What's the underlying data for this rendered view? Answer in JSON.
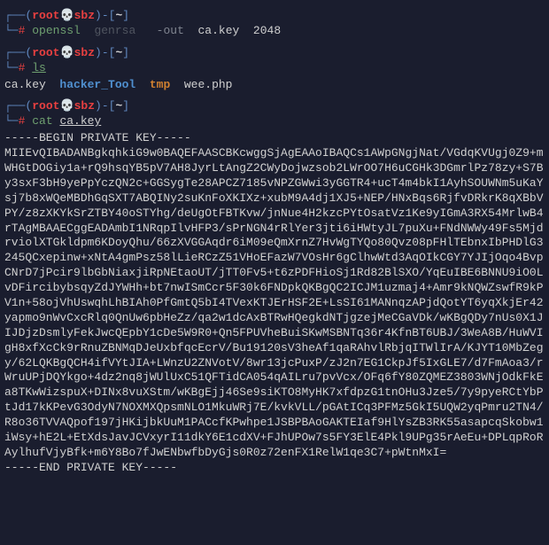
{
  "prompt": {
    "dash_pre": "┌──",
    "lparen": "(",
    "user": "root",
    "skull": "💀",
    "host": "sbz",
    "rparen": ")",
    "sep": "-",
    "lbracket": "[",
    "path": "~",
    "rbracket": "]",
    "dash_cont": "└─",
    "hash": "#"
  },
  "cmd1": {
    "bin": "openssl",
    "sub": "genrsa",
    "flag": "-out",
    "file": "ca.key",
    "bits": "2048"
  },
  "cmd2": {
    "bin": "ls"
  },
  "ls_out": {
    "f1": "ca.key",
    "d1": "hacker_Tool",
    "d2": "tmp",
    "f2": "wee.php"
  },
  "cmd3": {
    "bin": "cat",
    "file": "ca.key"
  },
  "key": {
    "begin": "-----BEGIN PRIVATE KEY-----",
    "body": "MIIEvQIBADANBgkqhkiG9w0BAQEFAASCBKcwggSjAgEAAoIBAQCs1AWpGNgjNat/VGdqKVUgj0Z9+mWHGtDOGiy1a+rQ9hsqYB5pV7AH8JyrLtAngZ2CWyDojwzsob2LWrOO7H6uCGHk3DGmrlPz78zy+S7By3sxF3bH9yePpYczQN2c+GGSygTe28APCZ7185vNPZGWwi3yGGTR4+ucT4m4bkI1AyhSOUWNm5uKaYsj7b8xWQeMBDhGqSXT7ABQINy2suKnFoXKIXz+xubM9A4dj1XJ5+NEP/HNxBqs6RjfvDRkrK8qXBbVPY/z8zXKYkSrZTBY40oSTYhg/deUgOtFBTKvw/jnNue4H2kzcPYtOsatVz1Ke9yIGmA3RX54MrlwB4rTAgMBAAECggEADAmbI1NRqpIlvHFP3/sPrNGN4rRlYer3jti6iHWtyJL7puXu+FNdNWWy49Fs5MjdrviolXTGkldpm6KDoyQhu/66zXVGGAqdr6iM09eQmXrnZ7HvWgTYQo80Qvz08pFHlTEbnxIbPHDlG3245QCxepinw+xNtA4gmPsz58lLieRCzZ51VHoEFazW7VOsHr6gClhwWtd3AqOIkCGY7YJIjOqo4BvpCNrD7jPcir9lbGbNiaxjiRpNEtaoUT/jTT0Fv5+t6zPDFHioSj1Rd82BlSXO/YqEuIBE6BNNU9iO0LvDFircibybsqyZdJYWHh+bt7nwISmCcr5F30k6FNDpkQKBgQC2ICJM1uzmaj4+Amr9kNQWZswfR9kPV1n+58ojVhUswqhLhBIAh0PfGmtQ5bI4TVexKTJErHSF2E+LsSI61MANnqzAPjdQotYT6yqXkjEr42yapmo9nWvCxcRlq0QnUw6pbHeZz/qa2w1dcAxBTRwHQegkdNTjgzejMeCGaVDk/wKBgQDy7nUs0X1JIJDjzDsmlyFekJwcQEpbY1cDe5W9R0+Qn5FPUVheBuiSKwMSBNTq36r4KfnBT6UBJ/3WeA8B/HuWVIgH8xfXcCk9rRnuZBNMqDJeUxbfqcEcrV/Bu19120sV3heAf1qaRAhvlRbjqITWlIrA/KJYT10MbZegy/62LQKBgQCH4ifVYtJIA+LWnzU2ZNVotV/8wr13jcPuxP/zJ2n7EG1CkpJf5IxGLE7/d7FmAoa3/rWruUPjDQYkgo+4dz2nq8jWUlUxC51QFTidCA054qAILru7pvVcx/OFq6fY80ZQMEZ3803WNjOdkFkEa8TKwWizspuX+DINx8vuXStm/wKBgEjj46Se9siKTO8MyHK7xfdpzG1tnOHu3Jze5/7y9pyeRCtYbPtJd17kKPevG3OdyN7NOXMXQpsmNLO1MkuWRj7E/kvkVLL/pGAtICq3PFMz5GkI5UQW2yqPmru2TN4/R8o36TVVAQpof197jHKijbkUuM1PACcfKPwhpe1JSBPBAoGAKTEIaf9HlYsZB3RK55asapcqSkobw1iWsy+hE2L+EtXdsJavJCVxyrI11dkY6E1cdXV+FJhUPOw7s5FY3ElE4Pkl9UPg35rAeEu+DPLqpRoRAylhufVjyBfk+m6Y8Bo7fJwENbwfbDyGjs0R0z72enFX1RelW1qe3C7+pWtnMxI=",
    "end": "-----END PRIVATE KEY-----"
  }
}
